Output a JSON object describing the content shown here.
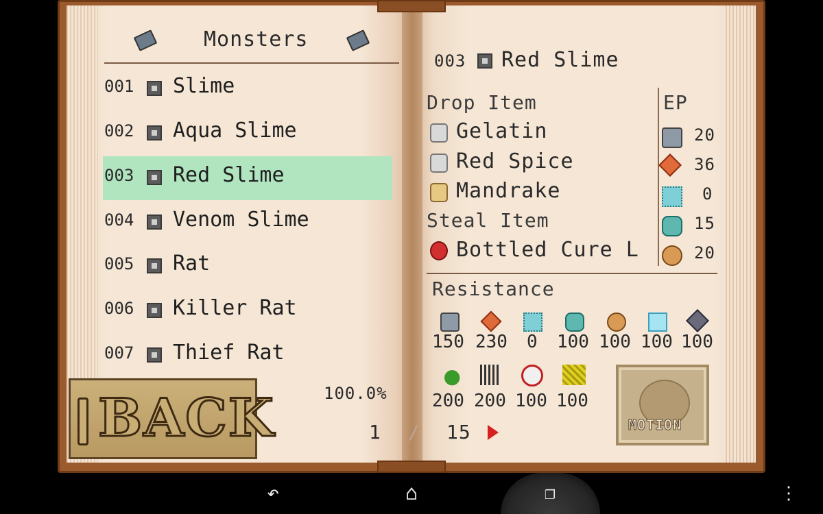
{
  "left_page": {
    "title": "Monsters",
    "monsters": [
      {
        "num": "001",
        "name": "Slime"
      },
      {
        "num": "002",
        "name": "Aqua Slime"
      },
      {
        "num": "003",
        "name": "Red Slime"
      },
      {
        "num": "004",
        "name": "Venom Slime"
      },
      {
        "num": "005",
        "name": "Rat"
      },
      {
        "num": "006",
        "name": "Killer Rat"
      },
      {
        "num": "007",
        "name": "Thief Rat"
      }
    ],
    "selected_index": 2,
    "completion": "100.0%",
    "page_current": "1",
    "page_separator": "/",
    "page_total": "15",
    "back_label": "BACK"
  },
  "detail": {
    "num": "003",
    "name": "Red Slime",
    "drop_label": "Drop Item",
    "drops": [
      "Gelatin",
      "Red Spice",
      "Mandrake"
    ],
    "steal_label": "Steal Item",
    "steal": "Bottled Cure L",
    "ep_label": "EP",
    "ep_values": [
      "20",
      "36",
      "0",
      "15",
      "20"
    ],
    "resistance_label": "Resistance",
    "resistances_row1": [
      "150",
      "230",
      "0",
      "100",
      "100",
      "100",
      "100"
    ],
    "resistances_row2": [
      "200",
      "200",
      "100",
      "100"
    ],
    "motion_label": "MOTION"
  },
  "colors": {
    "selected_row": "#b0e5c0",
    "cover": "#9a5a2c",
    "page": "#f5e6d5",
    "arrow": "#d62020"
  },
  "nav_icons": [
    "back-icon",
    "home-icon",
    "recent-apps-icon",
    "menu-icon"
  ]
}
